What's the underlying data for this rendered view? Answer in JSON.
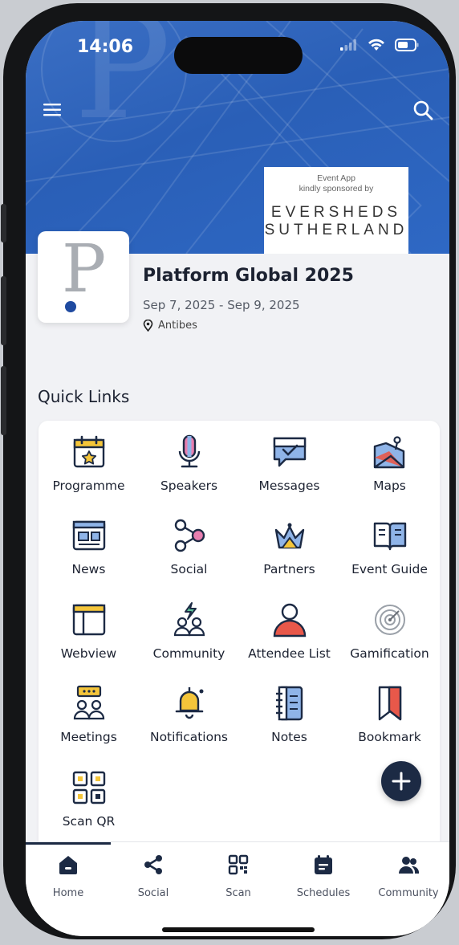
{
  "status": {
    "time": "14:06"
  },
  "header": {
    "menu_icon": "hamburger-icon",
    "search_icon": "search-icon"
  },
  "sponsor": {
    "line1": "Event App",
    "line2": "kindly sponsored by",
    "name_line1": "EVERSHEDS",
    "name_line2": "SUTHERLAND"
  },
  "event": {
    "logo_letter": "P",
    "title": "Platform Global 2025",
    "dates": "Sep 7, 2025 - Sep 9, 2025",
    "location": "Antibes"
  },
  "quick_links": {
    "title": "Quick Links",
    "items": [
      {
        "label": "Programme",
        "icon": "calendar-icon"
      },
      {
        "label": "Speakers",
        "icon": "microphone-icon"
      },
      {
        "label": "Messages",
        "icon": "message-icon"
      },
      {
        "label": "Maps",
        "icon": "map-icon"
      },
      {
        "label": "News",
        "icon": "news-icon"
      },
      {
        "label": "Social",
        "icon": "share-icon"
      },
      {
        "label": "Partners",
        "icon": "crown-icon"
      },
      {
        "label": "Event Guide",
        "icon": "book-icon"
      },
      {
        "label": "Webview",
        "icon": "browser-icon"
      },
      {
        "label": "Community",
        "icon": "community-icon"
      },
      {
        "label": "Attendee List",
        "icon": "person-icon"
      },
      {
        "label": "Gamification",
        "icon": "target-icon"
      },
      {
        "label": "Meetings",
        "icon": "meetings-icon"
      },
      {
        "label": "Notifications",
        "icon": "bell-icon"
      },
      {
        "label": "Notes",
        "icon": "notes-icon"
      },
      {
        "label": "Bookmark",
        "icon": "bookmark-icon"
      },
      {
        "label": "Scan QR",
        "icon": "qr-icon"
      }
    ]
  },
  "fab": {
    "icon": "plus-icon"
  },
  "tabs": [
    {
      "label": "Home",
      "icon": "home-icon"
    },
    {
      "label": "Social",
      "icon": "share-icon"
    },
    {
      "label": "Scan",
      "icon": "qr-icon"
    },
    {
      "label": "Schedules",
      "icon": "schedule-icon"
    },
    {
      "label": "Community",
      "icon": "people-icon"
    }
  ],
  "colors": {
    "banner": "#2e65bf",
    "dark": "#1c2a44",
    "accent_yellow": "#f4c53a",
    "accent_red": "#e8584a",
    "accent_blue": "#8fb4e8"
  }
}
